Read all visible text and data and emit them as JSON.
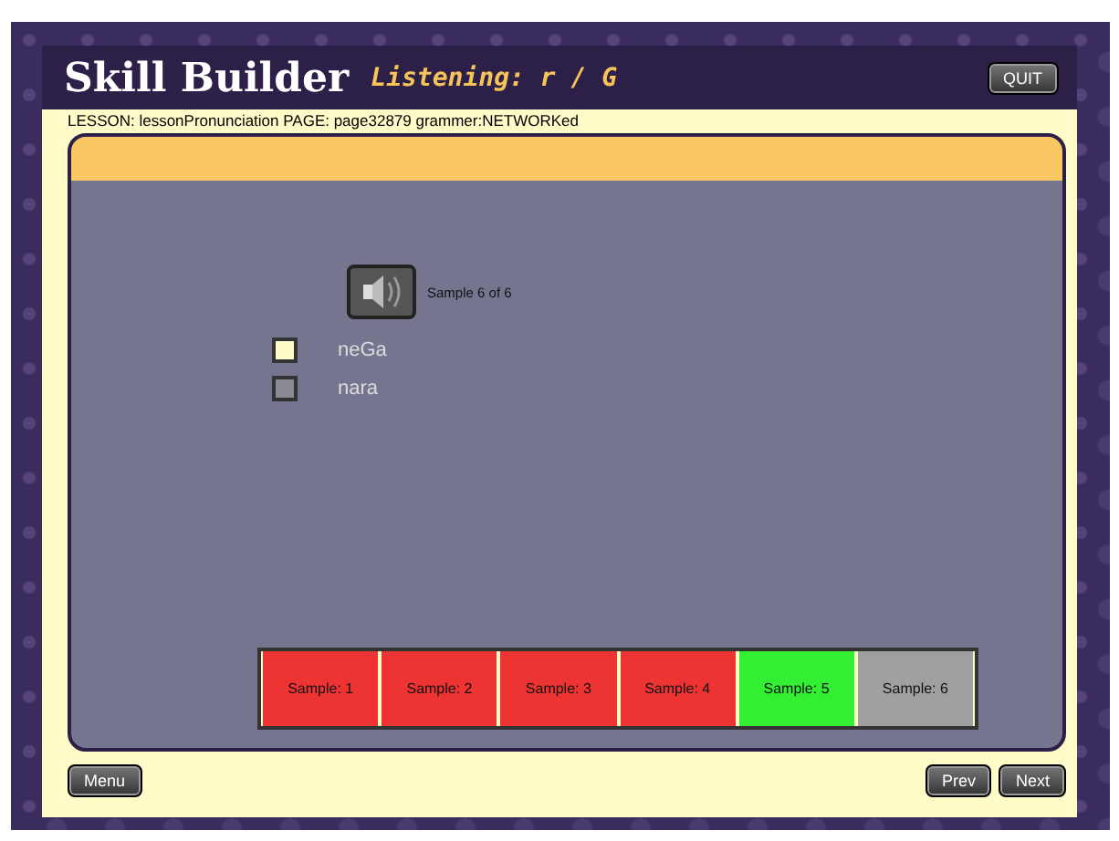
{
  "header": {
    "title": "Skill Builder",
    "subtitle": "Listening: r / G",
    "quit": "QUIT"
  },
  "lesson_line": "LESSON: lessonPronunciation PAGE: page32879 grammer:NETWORKed",
  "player": {
    "caption": "Sample 6 of 6"
  },
  "options": [
    {
      "label": "neGa",
      "selected": true
    },
    {
      "label": "nara",
      "selected": false
    }
  ],
  "samples": [
    {
      "label": "Sample: 1",
      "color": "#ee3333"
    },
    {
      "label": "Sample: 2",
      "color": "#ee3333"
    },
    {
      "label": "Sample: 3",
      "color": "#ee3333"
    },
    {
      "label": "Sample: 4",
      "color": "#ee3333"
    },
    {
      "label": "Sample: 5",
      "color": "#33ee33"
    },
    {
      "label": "Sample: 6",
      "color": "#a0a0a0"
    }
  ],
  "footer": {
    "menu": "Menu",
    "prev": "Prev",
    "next": "Next"
  }
}
